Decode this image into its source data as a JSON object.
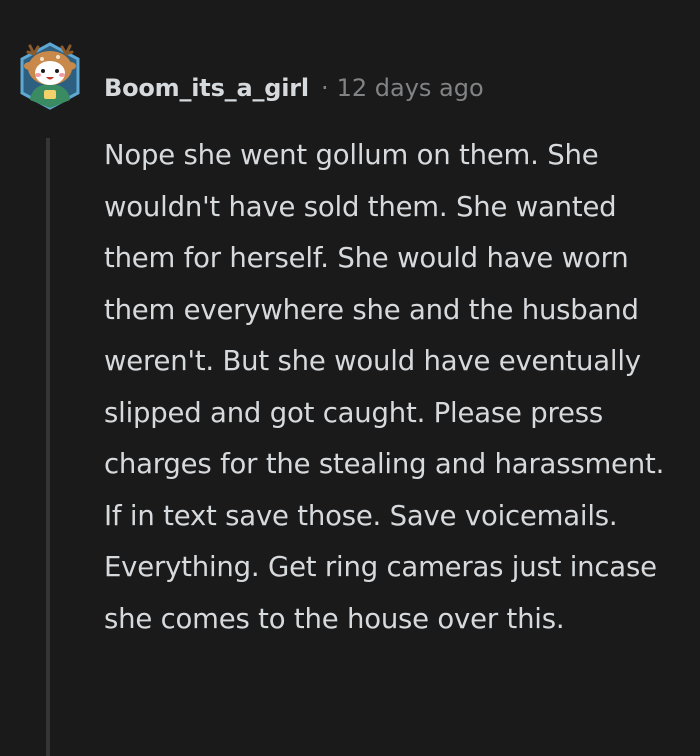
{
  "comment": {
    "author": "Boom_its_a_girl",
    "separator": "·",
    "timestamp": "12 days ago",
    "body": "Nope she went gollum on them. She wouldn't have sold them. She wanted them for herself. She would have worn them everywhere she and the husband weren't. But she would have eventually slipped and got caught. Please press charges for the stealing and harassment. If in text save those. Save voicemails. Everything. Get ring cameras just incase she comes to the house over this."
  },
  "avatar": {
    "icon": "snoo-avatar-deer-hood",
    "frame_color": "#4a90b8",
    "hood_color": "#c8894a",
    "shirt_color": "#3a8a62"
  },
  "colors": {
    "background": "#1a1a1b",
    "text": "#d7dadc",
    "meta": "#818384",
    "thread_line": "#343536"
  }
}
